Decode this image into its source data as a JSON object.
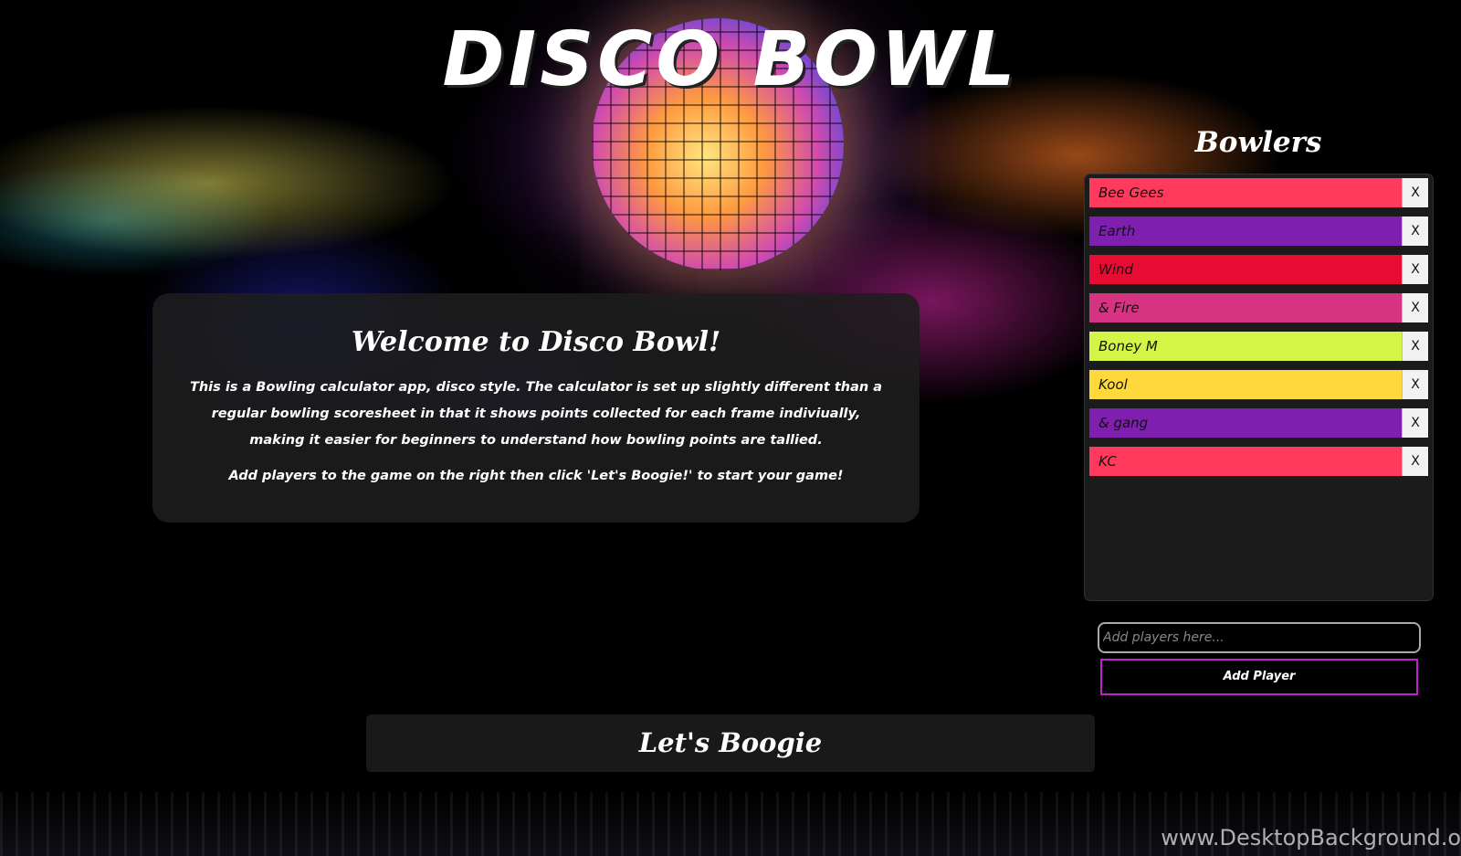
{
  "logo": {
    "text": "DISCO BOWL"
  },
  "welcome": {
    "title": "Welcome to Disco Bowl!",
    "description": "This is a Bowling calculator app, disco style. The calculator is set up slightly different than a regular bowling scoresheet in that it shows points collected for each frame indiviually, making it easier for beginners to understand how bowling points are tallied.",
    "instructions": "Add players to the game on the right then click 'Let's Boogie!' to start your game!"
  },
  "start_button": {
    "label": "Let's Boogie"
  },
  "bowlers": {
    "title": "Bowlers",
    "remove_label": "X",
    "items": [
      {
        "name": "Bee Gees",
        "color": "#ff3a5c"
      },
      {
        "name": "Earth",
        "color": "#7e1fb0"
      },
      {
        "name": "Wind",
        "color": "#e80c34"
      },
      {
        "name": "& Fire",
        "color": "#d63383"
      },
      {
        "name": "Boney M",
        "color": "#d4f545"
      },
      {
        "name": "Kool",
        "color": "#ffd93c"
      },
      {
        "name": "& gang",
        "color": "#7e1fb0"
      },
      {
        "name": "KC",
        "color": "#ff3a5c"
      }
    ]
  },
  "add_player": {
    "placeholder": "Add players here...",
    "button_label": "Add Player"
  },
  "watermark": "www.DesktopBackground.o"
}
